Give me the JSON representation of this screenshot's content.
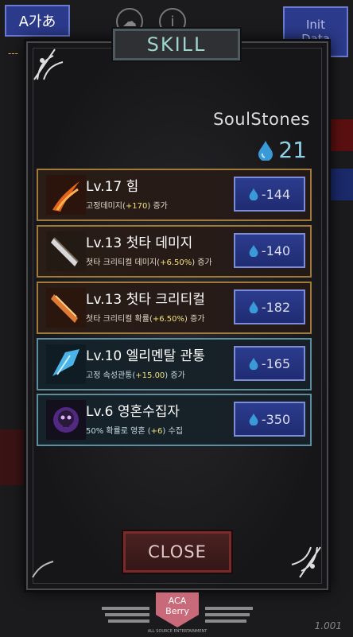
{
  "top": {
    "lang_label": "A가あ",
    "init_line1": "Init",
    "init_line2": "Data",
    "dashes": "---"
  },
  "panel": {
    "title": "SKILL",
    "soulstones_label": "SoulStones",
    "soulstones_count": "21",
    "close_label": "CLOSE"
  },
  "skills": [
    {
      "name": "Lv.17 힘",
      "desc_pre": "고정데미지(",
      "desc_val": "+170",
      "desc_post": ") 증가",
      "cost": "-144",
      "icon": "fire-claw-icon",
      "theme": "orange"
    },
    {
      "name": "Lv.13 첫타 데미지",
      "desc_pre": "첫타 크리티컬 데미지(",
      "desc_val": "+6.50%",
      "desc_post": ") 증가",
      "cost": "-140",
      "icon": "blade-icon",
      "theme": "orange"
    },
    {
      "name": "Lv.13 첫타 크리티컬",
      "desc_pre": "첫타 크리티컬 확률(",
      "desc_val": "+6.50%",
      "desc_post": ") 증가",
      "cost": "-182",
      "icon": "flame-blade-icon",
      "theme": "orange"
    },
    {
      "name": "Lv.10 엘리멘탈 관통",
      "desc_pre": "고정 속성관통(",
      "desc_val": "+15.00",
      "desc_post": ") 증가",
      "cost": "-165",
      "icon": "ice-crystal-icon",
      "theme": "blue"
    },
    {
      "name": "Lv.6 영혼수집자",
      "desc_pre": "50% 확률로 영혼 (",
      "desc_val": "+6",
      "desc_post": ") 수집",
      "cost": "-350",
      "icon": "skull-soul-icon",
      "theme": "blue"
    }
  ],
  "footer": {
    "logo_line1": "ACA",
    "logo_line2": "Berry",
    "logo_sub": "ALL SOURCE ENTERTAINMENT",
    "version": "1.001"
  },
  "colors": {
    "accent_blue": "#2b3a8a",
    "soulstone": "#8fd0e6",
    "highlight": "#f0e27a",
    "close_red": "#4a2222"
  }
}
